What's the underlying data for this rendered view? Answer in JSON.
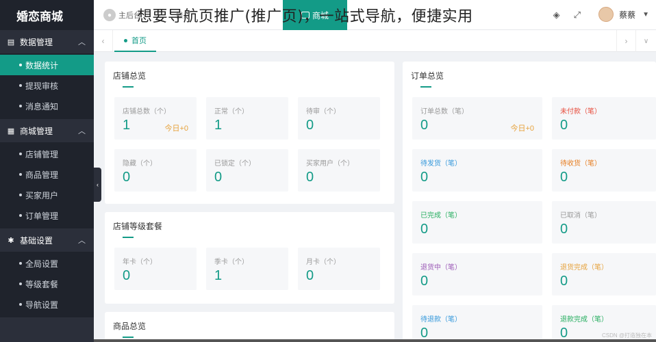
{
  "overlay_caption": "想要导航页推广(推广页)，一站式导航，便捷实用",
  "logo": "婚恋商城",
  "sidebar": {
    "groups": [
      {
        "label": "数据管理",
        "icon": "clipboard-icon",
        "items": [
          "数据统计",
          "提现审核",
          "消息通知"
        ]
      },
      {
        "label": "商城管理",
        "icon": "shop-icon",
        "items": [
          "店铺管理",
          "商品管理",
          "买家用户",
          "订单管理"
        ]
      },
      {
        "label": "基础设置",
        "icon": "gear-icon",
        "items": [
          "全局设置",
          "等级套餐",
          "导航设置"
        ]
      }
    ],
    "active_item": "数据统计"
  },
  "topbar": {
    "home_label": "主后台",
    "breadcrumb": "推广",
    "switch_label": "商城",
    "user_name": "蔡蔡"
  },
  "tabs": {
    "home": "首页"
  },
  "shop_overview": {
    "title": "店铺总览",
    "stats": [
      {
        "label": "店铺总数（个）",
        "value": "1",
        "today": "今日+0"
      },
      {
        "label": "正常（个）",
        "value": "1"
      },
      {
        "label": "待审（个）",
        "value": "0"
      },
      {
        "label": "隐藏（个）",
        "value": "0"
      },
      {
        "label": "已锁定（个）",
        "value": "0"
      },
      {
        "label": "买家用户（个）",
        "value": "0"
      }
    ]
  },
  "shop_level": {
    "title": "店铺等级套餐",
    "stats": [
      {
        "label": "年卡（个）",
        "value": "0"
      },
      {
        "label": "季卡（个）",
        "value": "1"
      },
      {
        "label": "月卡（个）",
        "value": "0"
      }
    ]
  },
  "goods_overview": {
    "title": "商品总览"
  },
  "order_overview": {
    "title": "订单总览",
    "stats": [
      {
        "label": "订单总数（笔）",
        "value": "0",
        "today": "今日+0",
        "label_color": "#999999"
      },
      {
        "label": "未付款（笔）",
        "value": "0",
        "label_color": "#e74c3c"
      },
      {
        "label": "待发货（笔）",
        "value": "0",
        "label_color": "#3498db"
      },
      {
        "label": "待收货（笔）",
        "value": "0",
        "label_color": "#e67e22"
      },
      {
        "label": "已完成（笔）",
        "value": "0",
        "label_color": "#27ae60"
      },
      {
        "label": "已取消（笔）",
        "value": "0",
        "label_color": "#999999"
      },
      {
        "label": "退货中（笔）",
        "value": "0",
        "label_color": "#9b59b6"
      },
      {
        "label": "退货完成（笔）",
        "value": "0",
        "label_color": "#e6a23c"
      },
      {
        "label": "待退款（笔）",
        "value": "0",
        "label_color": "#3498db"
      },
      {
        "label": "退款完成（笔）",
        "value": "0",
        "label_color": "#27ae60"
      }
    ]
  },
  "watermark": "CSDN @打造独在本",
  "colors": {
    "accent": "#139b87",
    "sidebar": "#2b2f3a",
    "today": "#e6a23c"
  }
}
